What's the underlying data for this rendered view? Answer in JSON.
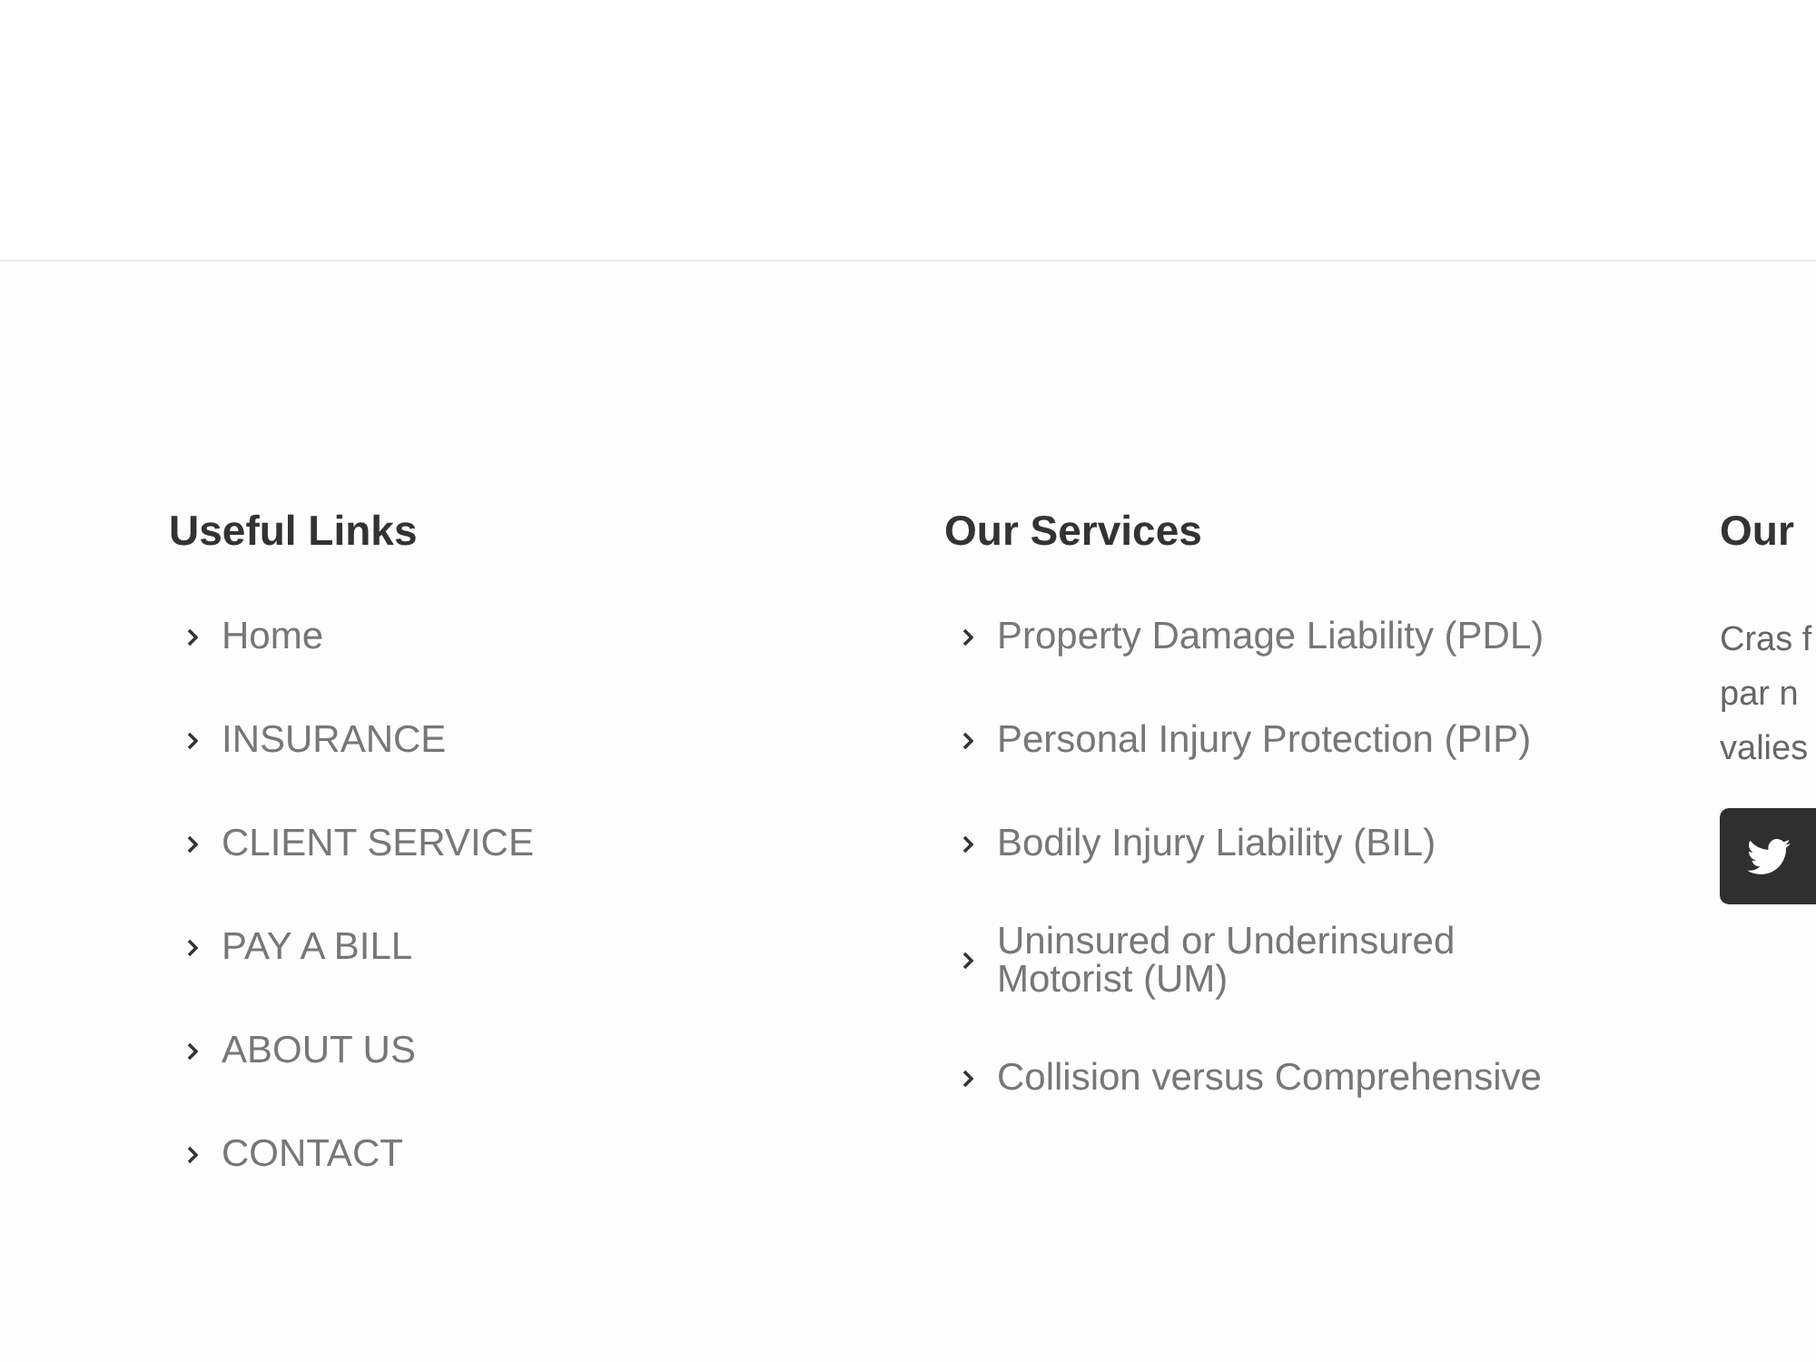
{
  "columns": [
    {
      "kind": "links",
      "heading": "Useful Links",
      "items": [
        "Home",
        "INSURANCE",
        "CLIENT SERVICE",
        "PAY A BILL",
        "ABOUT US",
        "CONTACT"
      ]
    },
    {
      "kind": "links",
      "heading": "Our Services",
      "items": [
        "Property Damage Liability (PDL)",
        "Personal Injury Protection (PIP)",
        "Bodily Injury Liability (BIL)",
        "Uninsured or Underinsured Motorist (UM)",
        "Collision versus Comprehensive"
      ]
    },
    {
      "kind": "about",
      "heading": "Our",
      "lines": [
        "Cras f",
        "par n",
        "valies"
      ]
    }
  ]
}
